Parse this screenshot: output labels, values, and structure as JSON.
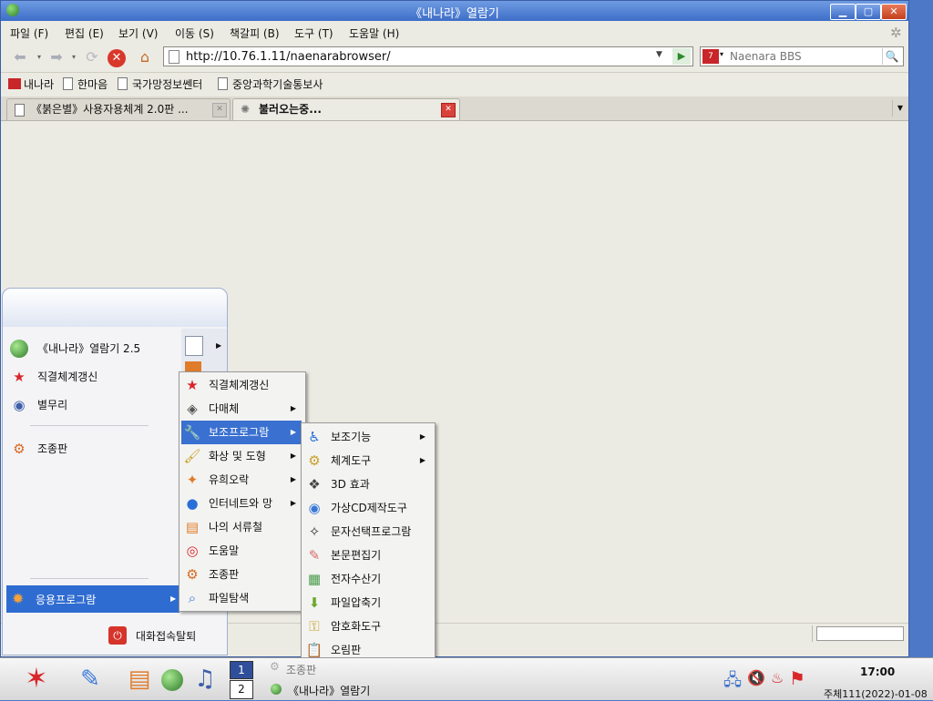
{
  "window": {
    "title": "《내나라》열람기",
    "min": "▁",
    "max": "▢",
    "close": "✕"
  },
  "menubar": [
    "파일 (F)",
    "편집 (E)",
    "보기 (V)",
    "이동 (S)",
    "책갈피 (B)",
    "도구 (T)",
    "도움말 (H)"
  ],
  "navbar": {
    "url": "http://10.76.1.11/naenarabrowser/",
    "search_placeholder": "Naenara BBS"
  },
  "bookmarks": [
    "내나라",
    "한마음",
    "국가망정보쎈터",
    "중앙과학기술통보사"
  ],
  "tabs": [
    {
      "label": "《붉은별》사용자용체계 2.0판 ..."
    },
    {
      "label": "불러오는중..."
    }
  ],
  "start_menu": {
    "items": [
      {
        "label": "《내나라》열람기 2.5",
        "icon": "globe-icon"
      },
      {
        "label": "직결체계갱신",
        "icon": "star-icon"
      },
      {
        "label": "별무리",
        "icon": "group-icon"
      },
      {
        "label": "조종판",
        "icon": "control-panel-icon"
      }
    ],
    "apps_label": "응용프로그람",
    "logout_label": "대화접속탈퇴"
  },
  "apps_menu": [
    {
      "label": "직결체계갱신",
      "icon": "star-icon",
      "arrow": false
    },
    {
      "label": "다매체",
      "icon": "multimedia-icon",
      "arrow": true
    },
    {
      "label": "보조프로그람",
      "icon": "tools-icon",
      "arrow": true
    },
    {
      "label": "화상 및 도형",
      "icon": "image-icon",
      "arrow": true
    },
    {
      "label": "유희오락",
      "icon": "game-icon",
      "arrow": true
    },
    {
      "label": "인터네트와 망",
      "icon": "internet-icon",
      "arrow": true
    },
    {
      "label": "나의 서류철",
      "icon": "folder-icon",
      "arrow": false
    },
    {
      "label": "도움말",
      "icon": "help-icon",
      "arrow": false
    },
    {
      "label": "조종판",
      "icon": "control-panel-icon",
      "arrow": false
    },
    {
      "label": "파일탐색",
      "icon": "file-search-icon",
      "arrow": false
    }
  ],
  "accessories_menu": [
    {
      "label": "보조기능",
      "icon": "accessibility-icon",
      "arrow": true
    },
    {
      "label": "체계도구",
      "icon": "system-tools-icon",
      "arrow": true
    },
    {
      "label": "3D 효과",
      "icon": "3d-effect-icon",
      "arrow": false
    },
    {
      "label": "가상CD제작도구",
      "icon": "cd-icon",
      "arrow": false
    },
    {
      "label": "문자선택프로그람",
      "icon": "char-select-icon",
      "arrow": false
    },
    {
      "label": "본문편집기",
      "icon": "text-editor-icon",
      "arrow": false
    },
    {
      "label": "전자수산기",
      "icon": "calculator-icon",
      "arrow": false
    },
    {
      "label": "파일압축기",
      "icon": "archive-icon",
      "arrow": false
    },
    {
      "label": "암호화도구",
      "icon": "encrypt-icon",
      "arrow": false
    },
    {
      "label": "오림판",
      "icon": "clipboard-icon",
      "arrow": false
    }
  ],
  "taskbar": {
    "workspaces": [
      "1",
      "2"
    ],
    "task_top": "조종판",
    "task_bottom": "《내나라》열람기",
    "time": "17:00",
    "date": "주체111(2022)-01-08"
  }
}
